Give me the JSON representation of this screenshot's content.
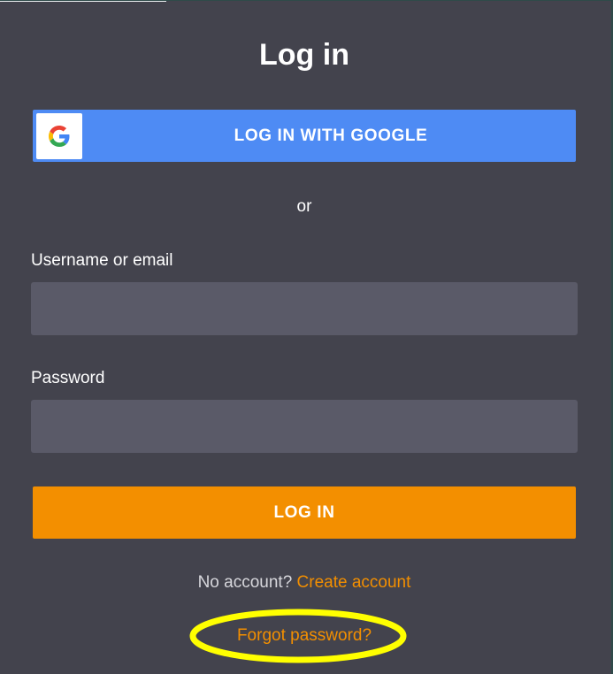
{
  "title": "Log in",
  "google_login": {
    "label": "LOG IN WITH GOOGLE",
    "icon": "google-logo-icon"
  },
  "divider_text": "or",
  "username": {
    "label": "Username or email",
    "value": "",
    "placeholder": ""
  },
  "password": {
    "label": "Password",
    "value": "",
    "placeholder": ""
  },
  "login_button": {
    "label": "LOG IN"
  },
  "signup": {
    "prompt": "No account?",
    "link": "Create account"
  },
  "forgot_password": {
    "link": "Forgot password?"
  },
  "annotation": {
    "shape": "ellipse",
    "target": "forgot-password-link"
  },
  "colors": {
    "background": "#43434d",
    "google_blue": "#4e8bf4",
    "accent_orange": "#f38f00",
    "input_bg": "#5a5a68",
    "highlight_yellow": "#ffff00"
  }
}
